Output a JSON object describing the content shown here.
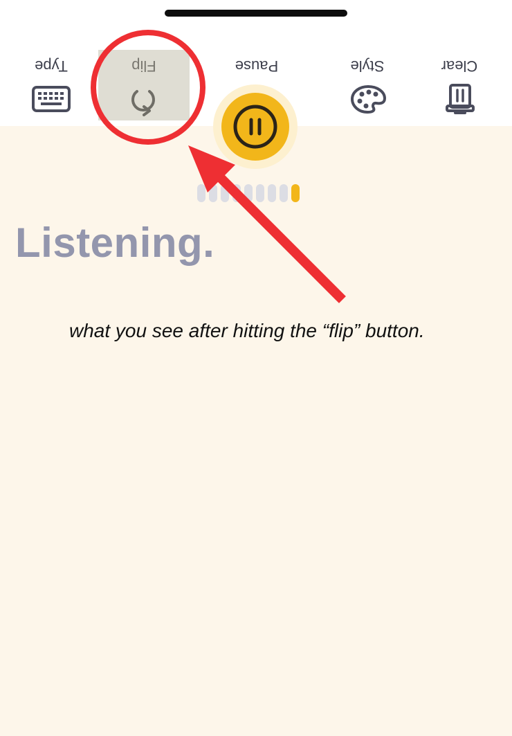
{
  "toolbar": {
    "items": [
      {
        "label": "Type",
        "icon": "keyboard-icon"
      },
      {
        "label": "Flip",
        "icon": "rotate-icon"
      },
      {
        "label": "Pause",
        "icon": "pause-icon"
      },
      {
        "label": "Style",
        "icon": "palette-icon"
      },
      {
        "label": "Clear",
        "icon": "clear-icon"
      }
    ]
  },
  "meter": {
    "segments": 9,
    "active_segment_index": 8
  },
  "status": {
    "text": "Listening."
  },
  "annotation": {
    "caption": "what you see after hitting the “flip” button."
  },
  "colors": {
    "background": "#fdf6ea",
    "toolbar": "#ffffff",
    "accent": "#f2b61a",
    "annotation_red": "#ee2f33",
    "status_text": "#9396ad",
    "icon": "#4a4c5c"
  }
}
